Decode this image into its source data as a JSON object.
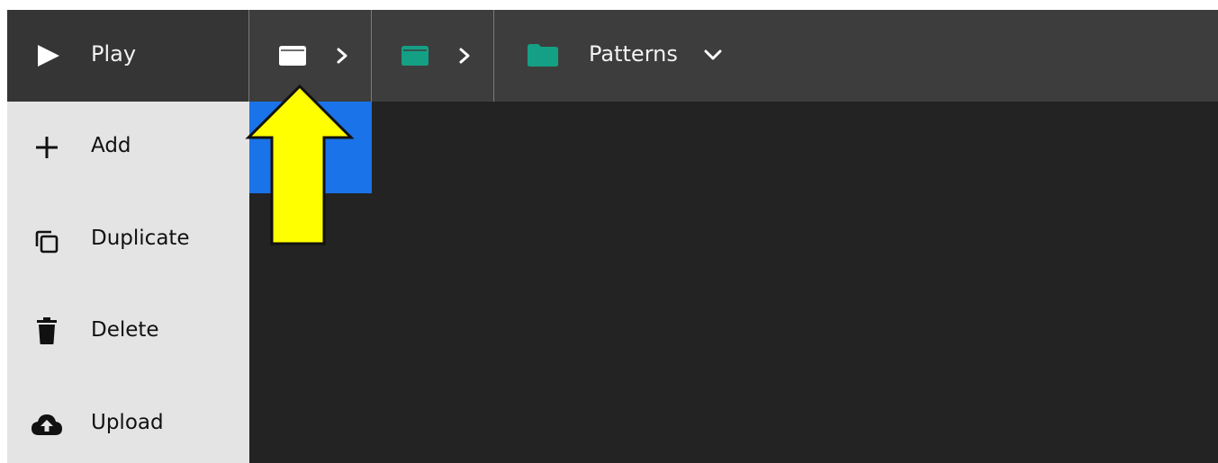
{
  "toolbar": {
    "play_label": "Play",
    "breadcrumbs": [
      {
        "icon": "folder-white-icon",
        "color": "#ffffff"
      },
      {
        "icon": "folder-teal-icon",
        "color": "#14a085"
      },
      {
        "icon": "folder-teal-icon",
        "color": "#14a085",
        "label": "Patterns"
      }
    ]
  },
  "menu": {
    "items": [
      {
        "label": "Add",
        "icon": "plus-icon"
      },
      {
        "label": "Duplicate",
        "icon": "duplicate-icon"
      },
      {
        "label": "Delete",
        "icon": "trash-icon"
      },
      {
        "label": "Upload",
        "icon": "cloud-upload-icon"
      }
    ]
  },
  "colors": {
    "toolbar_bg": "#3d3d3d",
    "menu_bg": "#e4e4e4",
    "content_bg": "#232323",
    "selection": "#1a73e8",
    "accent_teal": "#14a085",
    "annotation_arrow": "#ffff00"
  }
}
